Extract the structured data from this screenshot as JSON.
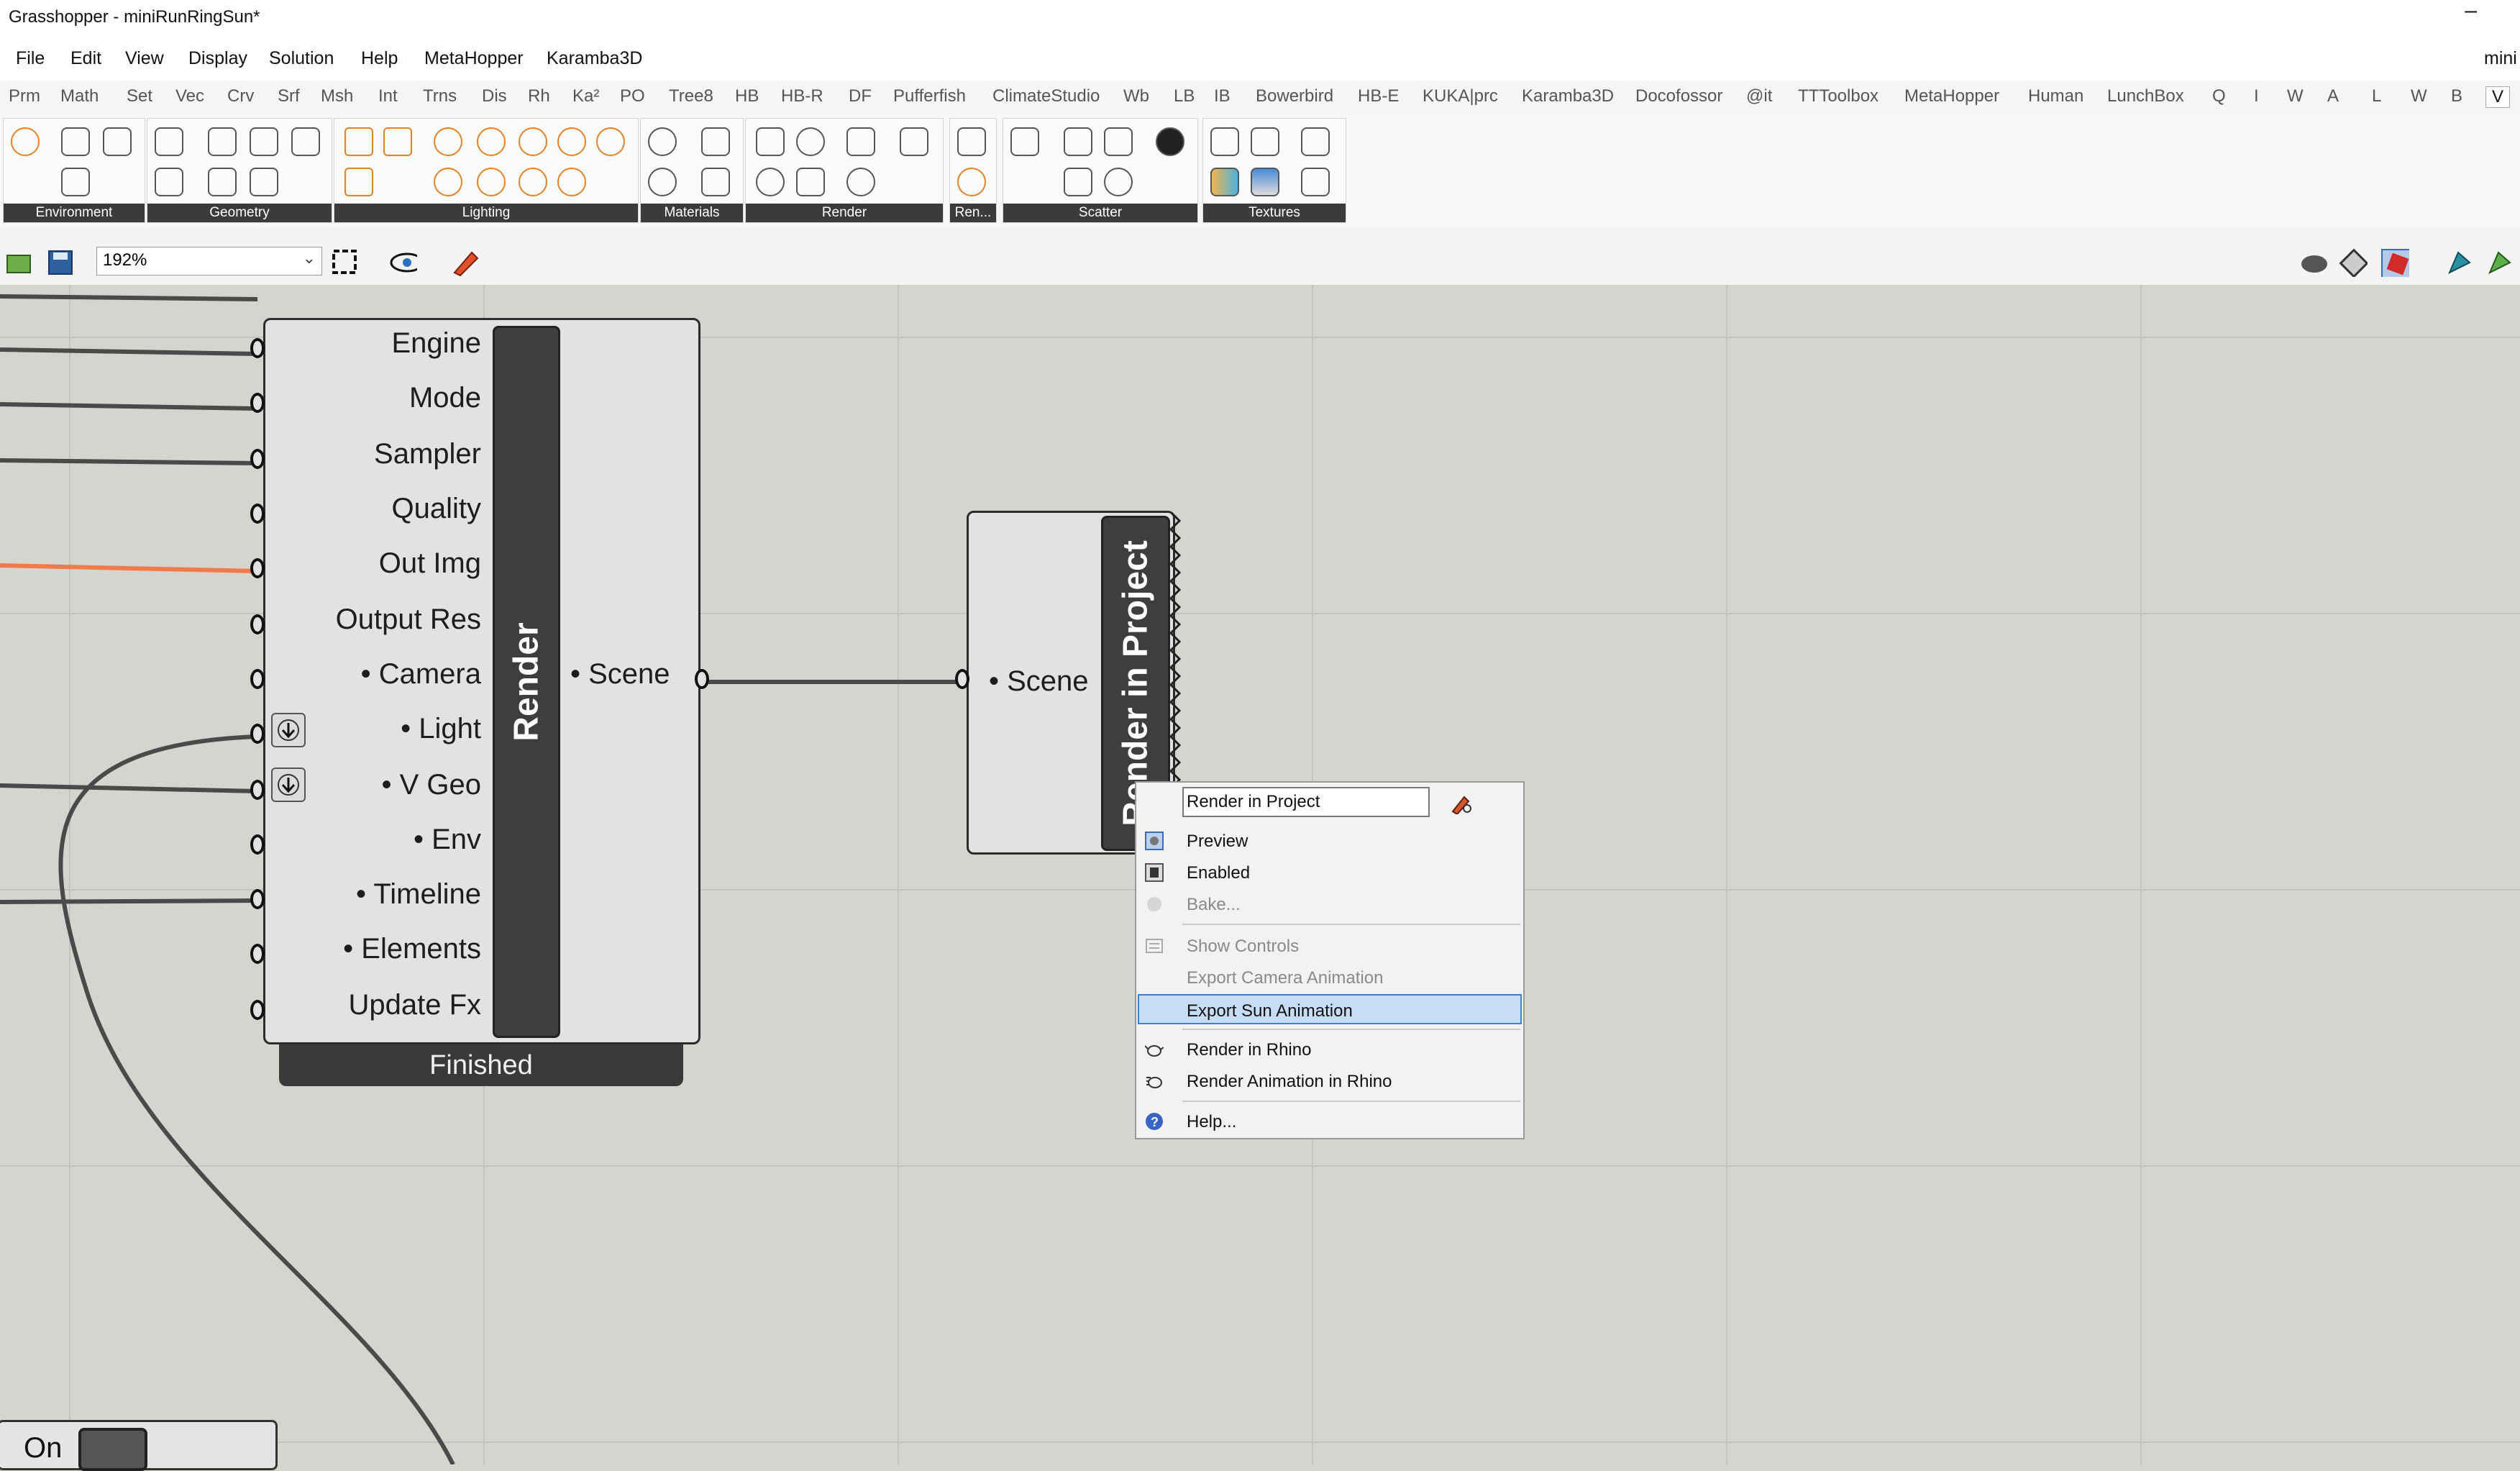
{
  "window": {
    "title": "Grasshopper - miniRunRingSun*",
    "minimize_glyph": "–"
  },
  "menubar": [
    "File",
    "Edit",
    "View",
    "Display",
    "Solution",
    "Help",
    "MetaHopper",
    "Karamba3D"
  ],
  "menubar_right": "mini",
  "tabs": [
    "Prm",
    "Math",
    "Set",
    "Vec",
    "Crv",
    "Srf",
    "Msh",
    "Int",
    "Trns",
    "Dis",
    "Rh",
    "Ka²",
    "PO",
    "Tree8",
    "HB",
    "HB-R",
    "DF",
    "Pufferfish",
    "ClimateStudio",
    "Wb",
    "LB",
    "IB",
    "Bowerbird",
    "HB-E",
    "KUKA|prc",
    "Karamba3D",
    "Docofossor",
    "@it",
    "TTToolbox",
    "MetaHopper",
    "Human",
    "LunchBox",
    "Q",
    "I",
    "W",
    "A",
    "L",
    "W",
    "B",
    "V"
  ],
  "ribbon_groups": [
    "Environment",
    "Geometry",
    "Lighting",
    "Materials",
    "Render",
    "Ren...",
    "Scatter",
    "Textures"
  ],
  "toolbar": {
    "zoom": "192%"
  },
  "render_component": {
    "title": "Render",
    "inputs": [
      "Engine",
      "Mode",
      "Sampler",
      "Quality",
      "Out Img",
      "Output Res",
      "• Camera",
      "• Light",
      "• V Geo",
      "• Env",
      "• Timeline",
      "• Elements",
      "Update Fx"
    ],
    "output": "• Scene",
    "status": "Finished"
  },
  "project_component": {
    "title": "Render in Project",
    "input": "• Scene"
  },
  "toggle": {
    "label": "On"
  },
  "context_menu": {
    "name_field": "Render in Project",
    "items": {
      "preview": "Preview",
      "enabled": "Enabled",
      "bake": "Bake...",
      "show_controls": "Show Controls",
      "export_camera": "Export Camera Animation",
      "export_sun": "Export Sun Animation",
      "render_rhino": "Render in Rhino",
      "render_anim_rhino": "Render Animation in Rhino",
      "help": "Help..."
    }
  },
  "colors": {
    "accent_wire": "#f07a4a",
    "wire": "#4a4a4a",
    "highlight": "#c7dcf5"
  }
}
